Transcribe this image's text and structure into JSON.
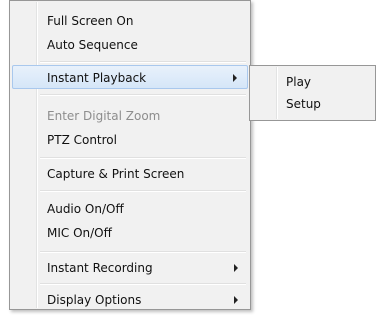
{
  "context_menu": {
    "items": [
      {
        "label": "Full Screen On"
      },
      {
        "label": "Auto Sequence"
      },
      {
        "label": "Instant Playback"
      },
      {
        "label": "Enter Digital Zoom"
      },
      {
        "label": "PTZ Control"
      },
      {
        "label": "Capture & Print Screen"
      },
      {
        "label": "Audio On/Off"
      },
      {
        "label": "MIC On/Off"
      },
      {
        "label": "Instant Recording"
      },
      {
        "label": "Display Options"
      }
    ]
  },
  "submenu": {
    "items": [
      {
        "label": "Play"
      },
      {
        "label": "Setup"
      }
    ]
  },
  "colors": {
    "menu_bg": "#f1f1f1",
    "border": "#979797",
    "highlight": "#d5e6f8",
    "disabled_text": "#8d8d8d"
  }
}
